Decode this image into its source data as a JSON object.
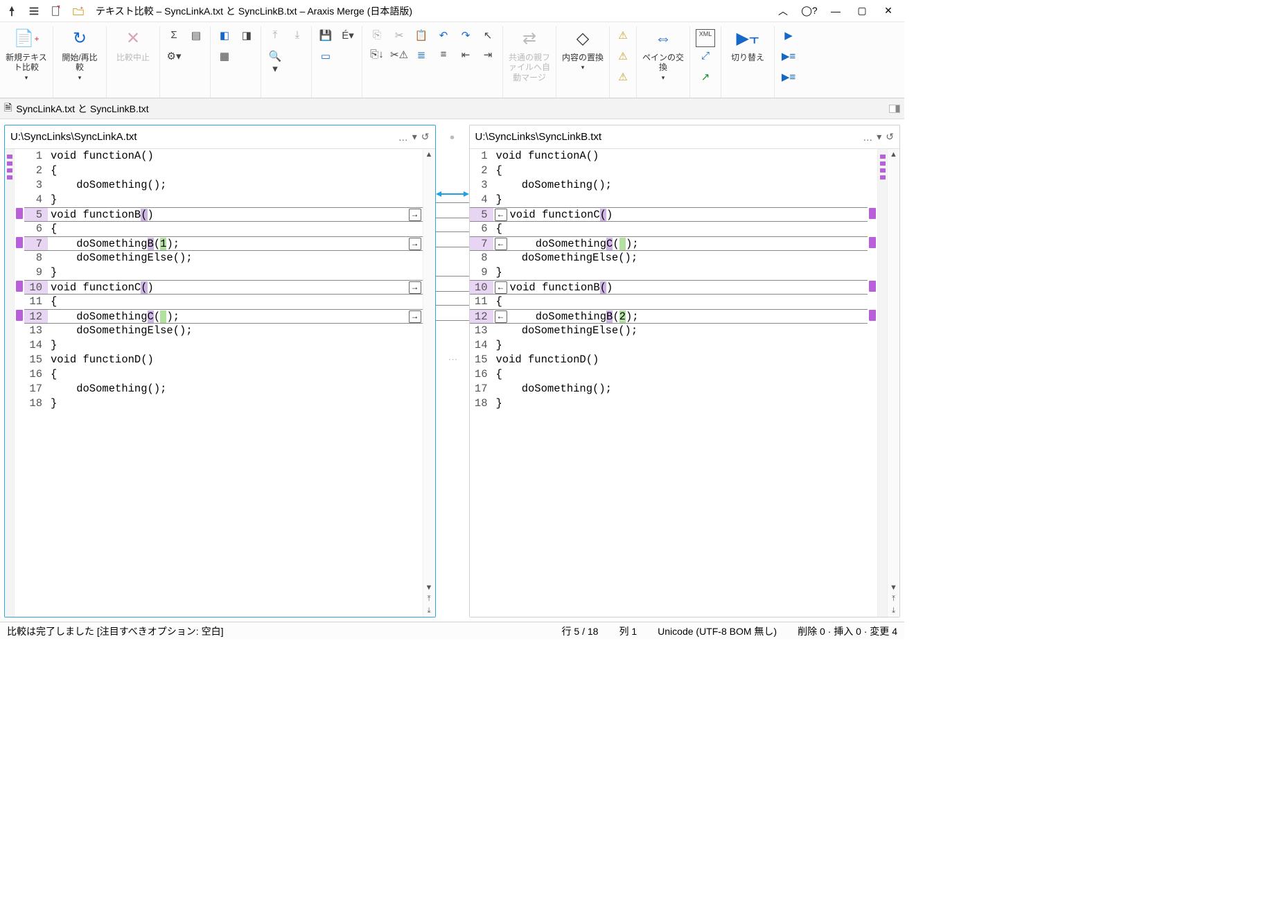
{
  "title": "テキスト比較 – SyncLinkA.txt と SyncLinkB.txt – Araxis Merge (日本語版)",
  "tab_label": "SyncLinkA.txt と SyncLinkB.txt",
  "ribbon": {
    "new_compare": "新規テキスト比較",
    "restart": "開始/再比較",
    "stop": "比較中止",
    "auto_merge": "共通の親ファイルへ自動マージ",
    "replace": "内容の置換",
    "swap_panes": "ペインの交換",
    "switch": "切り替え"
  },
  "paneA": {
    "path": "U:\\SyncLinks\\SyncLinkA.txt",
    "lines": [
      {
        "n": 1,
        "t": "void functionA()"
      },
      {
        "n": 2,
        "t": "{"
      },
      {
        "n": 3,
        "t": "    doSomething();"
      },
      {
        "n": 4,
        "t": "}"
      },
      {
        "n": 5,
        "t": "void functionB()",
        "chgrow": true,
        "merge": "→",
        "hl": [
          [
            14,
            1
          ]
        ]
      },
      {
        "n": 6,
        "t": "{"
      },
      {
        "n": 7,
        "t": "    doSomethingB(1);",
        "chgrow": true,
        "merge": "→",
        "hl": [
          [
            15,
            1
          ]
        ],
        "hlg": [
          [
            17,
            1
          ]
        ]
      },
      {
        "n": 8,
        "t": "    doSomethingElse();"
      },
      {
        "n": 9,
        "t": "}"
      },
      {
        "n": 10,
        "t": "void functionC()",
        "chgrow": true,
        "merge": "→",
        "hl": [
          [
            14,
            1
          ]
        ]
      },
      {
        "n": 11,
        "t": "{"
      },
      {
        "n": 12,
        "t": "    doSomethingC( );",
        "chgrow": true,
        "merge": "→",
        "hl": [
          [
            15,
            1
          ]
        ],
        "hlg": [
          [
            17,
            1
          ]
        ]
      },
      {
        "n": 13,
        "t": "    doSomethingElse();"
      },
      {
        "n": 14,
        "t": "}"
      },
      {
        "n": 15,
        "t": "void functionD()"
      },
      {
        "n": 16,
        "t": "{"
      },
      {
        "n": 17,
        "t": "    doSomething();"
      },
      {
        "n": 18,
        "t": "}"
      }
    ]
  },
  "paneB": {
    "path": "U:\\SyncLinks\\SyncLinkB.txt",
    "lines": [
      {
        "n": 1,
        "t": "void functionA()"
      },
      {
        "n": 2,
        "t": "{"
      },
      {
        "n": 3,
        "t": "    doSomething();"
      },
      {
        "n": 4,
        "t": "}"
      },
      {
        "n": 5,
        "t": "void functionC()",
        "chgrow": true,
        "merge": "←",
        "hl": [
          [
            14,
            1
          ]
        ]
      },
      {
        "n": 6,
        "t": "{"
      },
      {
        "n": 7,
        "t": "    doSomethingC( );",
        "chgrow": true,
        "merge": "←",
        "hl": [
          [
            15,
            1
          ]
        ],
        "hlg": [
          [
            17,
            1
          ]
        ]
      },
      {
        "n": 8,
        "t": "    doSomethingElse();"
      },
      {
        "n": 9,
        "t": "}"
      },
      {
        "n": 10,
        "t": "void functionB()",
        "chgrow": true,
        "merge": "←",
        "hl": [
          [
            14,
            1
          ]
        ]
      },
      {
        "n": 11,
        "t": "{"
      },
      {
        "n": 12,
        "t": "    doSomethingB(2);",
        "chgrow": true,
        "merge": "←",
        "hl": [
          [
            15,
            1
          ]
        ],
        "hlg": [
          [
            17,
            1
          ]
        ]
      },
      {
        "n": 13,
        "t": "    doSomethingElse();"
      },
      {
        "n": 14,
        "t": "}"
      },
      {
        "n": 15,
        "t": "void functionD()"
      },
      {
        "n": 16,
        "t": "{"
      },
      {
        "n": 17,
        "t": "    doSomething();"
      },
      {
        "n": 18,
        "t": "}"
      }
    ]
  },
  "status": {
    "msg": "比較は完了しました [注目すべきオプション: 空白]",
    "pos": "行 5 / 18",
    "col": "列 1",
    "encoding": "Unicode (UTF-8 BOM 無し)",
    "diff": "削除 0 · 挿入 0 · 変更 4"
  }
}
